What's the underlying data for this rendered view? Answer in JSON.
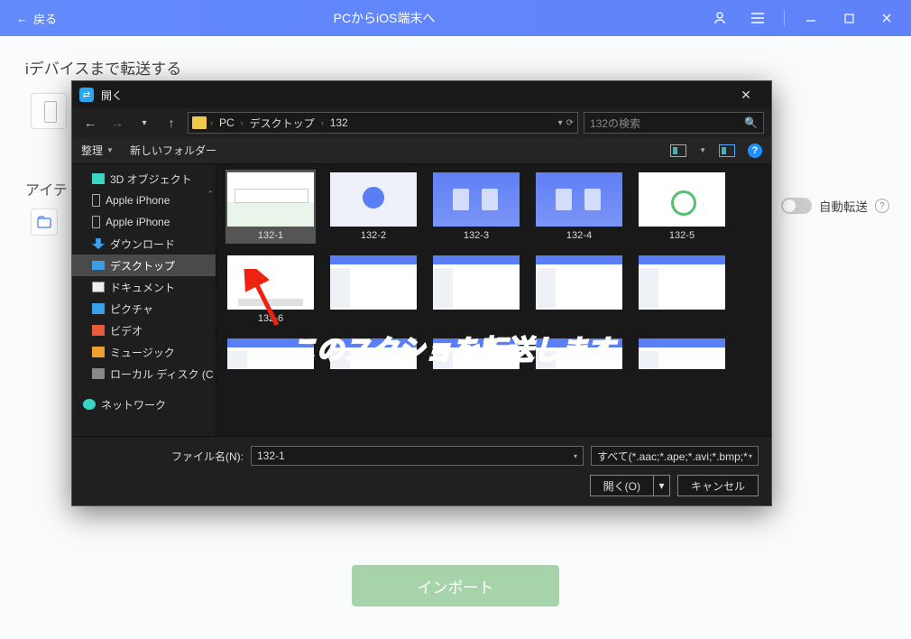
{
  "app": {
    "back_label": "戻る",
    "title": "PCからiOS端末へ"
  },
  "page": {
    "section_title": "iデバイスまで転送する",
    "item_label": "アイテ",
    "auto_transfer_label": "自動転送",
    "import_button": "インポート"
  },
  "dialog": {
    "title": "開く",
    "breadcrumb": {
      "a": "PC",
      "b": "デスクトップ",
      "c": "132"
    },
    "search_placeholder": "132の検索",
    "toolbar": {
      "organize": "整理",
      "new_folder": "新しいフォルダー"
    },
    "sidebar": {
      "items": [
        "3D オブジェクト",
        "Apple iPhone",
        "Apple iPhone",
        "ダウンロード",
        "デスクトップ",
        "ドキュメント",
        "ピクチャ",
        "ビデオ",
        "ミュージック",
        "ローカル ディスク (C",
        "ネットワーク"
      ]
    },
    "thumbs": {
      "r1": [
        "132-1",
        "132-2",
        "132-3",
        "132-4",
        "132-5"
      ],
      "r2": [
        "132-6",
        "",
        "",
        "",
        ""
      ]
    },
    "footer": {
      "filename_label": "ファイル名(N):",
      "filename_value": "132-1",
      "filter": "すべて(*.aac;*.ape;*.avi;*.bmp;*.e",
      "open": "開く(O)",
      "cancel": "キャンセル"
    }
  },
  "annotation": {
    "text": "このスクショを転送します"
  }
}
